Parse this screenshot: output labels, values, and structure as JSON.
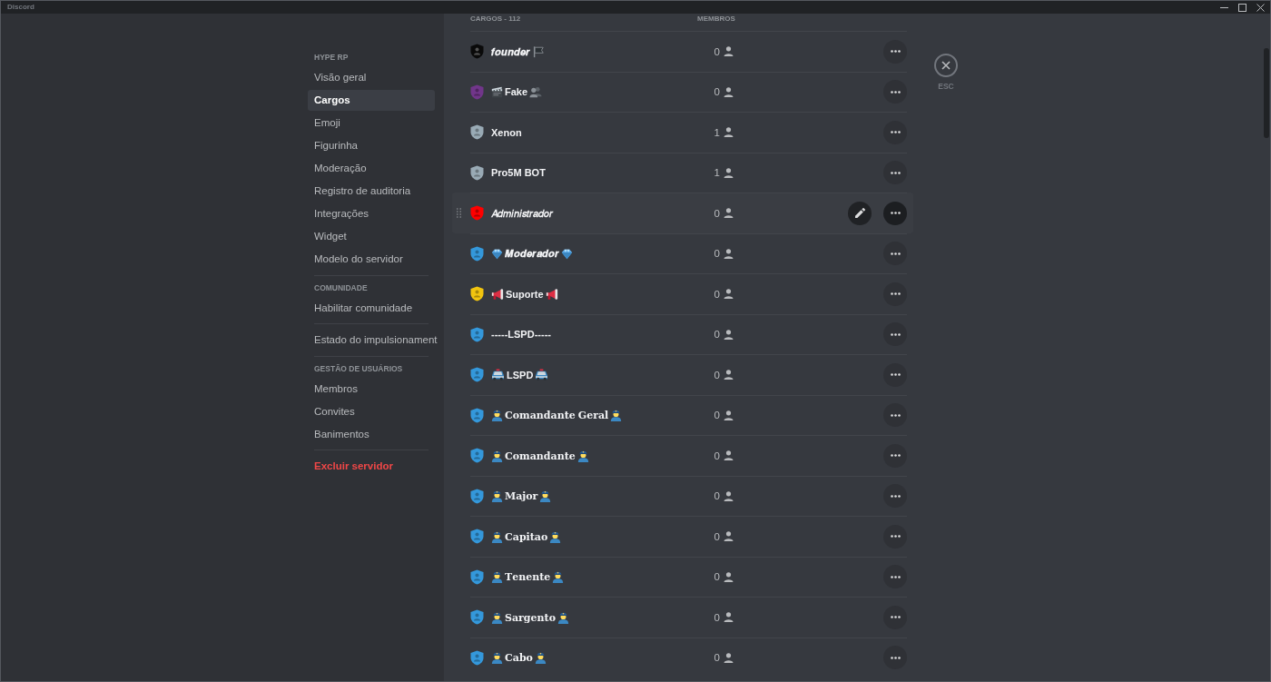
{
  "window": {
    "title": "Discord"
  },
  "sidebar": {
    "sections": [
      {
        "header": "HYPE RP",
        "items": [
          {
            "label": "Visão geral",
            "selected": false,
            "kind": "normal"
          },
          {
            "label": "Cargos",
            "selected": true,
            "kind": "normal"
          },
          {
            "label": "Emoji",
            "selected": false,
            "kind": "normal"
          },
          {
            "label": "Figurinha",
            "selected": false,
            "kind": "normal"
          },
          {
            "label": "Moderação",
            "selected": false,
            "kind": "normal"
          },
          {
            "label": "Registro de auditoria",
            "selected": false,
            "kind": "normal"
          },
          {
            "label": "Integrações",
            "selected": false,
            "kind": "normal"
          },
          {
            "label": "Widget",
            "selected": false,
            "kind": "normal"
          },
          {
            "label": "Modelo do servidor",
            "selected": false,
            "kind": "normal"
          }
        ]
      },
      {
        "header": "COMUNIDADE",
        "items": [
          {
            "label": "Habilitar comunidade",
            "selected": false,
            "kind": "normal"
          }
        ]
      },
      {
        "items": [
          {
            "label": "Estado do impulsionament",
            "selected": false,
            "kind": "normal"
          }
        ]
      },
      {
        "header": "GESTÃO DE USUÁRIOS",
        "items": [
          {
            "label": "Membros",
            "selected": false,
            "kind": "normal"
          },
          {
            "label": "Convites",
            "selected": false,
            "kind": "normal"
          },
          {
            "label": "Banimentos",
            "selected": false,
            "kind": "normal"
          }
        ]
      },
      {
        "items": [
          {
            "label": "Excluir servidor",
            "selected": false,
            "kind": "danger"
          }
        ]
      }
    ]
  },
  "roles_table": {
    "columns": [
      "CARGOS - 112",
      "MEMBROS"
    ],
    "roles": [
      {
        "name": "𝒇𝒐𝒖𝒏𝒅𝒆𝒓",
        "kind": "flag",
        "color": "#0a0a0a",
        "members": "0",
        "hovered": false
      },
      {
        "name": "Fake",
        "kind": "clapper",
        "color": "#71368a",
        "members": "0",
        "hovered": false
      },
      {
        "name": "Xenon",
        "kind": "plain",
        "color": "#99aab5",
        "members": "1",
        "hovered": false
      },
      {
        "name": "Pro5M BOT",
        "kind": "plain",
        "color": "#99aab5",
        "members": "1",
        "hovered": false
      },
      {
        "name": "𝐴𝑑𝑚𝑖𝑛𝑖𝑠𝑡𝑟𝑎𝑑𝑜𝑟",
        "kind": "plain",
        "color": "#ff0000",
        "members": "0",
        "hovered": true
      },
      {
        "name": "𝑴𝒐𝒅𝒆𝒓𝒂𝒅𝒐𝒓",
        "kind": "gem",
        "color": "#3498db",
        "members": "0",
        "hovered": false
      },
      {
        "name": "Suporte",
        "kind": "megaphone",
        "color": "#f1c40f",
        "members": "0",
        "hovered": false
      },
      {
        "name": "-----LSPD-----",
        "kind": "plain",
        "color": "#3498db",
        "members": "0",
        "hovered": false
      },
      {
        "name": "LSPD",
        "kind": "police-car",
        "color": "#3498db",
        "members": "0",
        "hovered": false
      },
      {
        "name": "𝐂𝐨𝐦𝐚𝐧𝐝𝐚𝐧𝐭𝐞 𝐆𝐞𝐫𝐚𝐥",
        "kind": "officer",
        "color": "#3498db",
        "members": "0",
        "hovered": false
      },
      {
        "name": "𝐂𝐨𝐦𝐚𝐧𝐝𝐚𝐧𝐭𝐞",
        "kind": "officer",
        "color": "#3498db",
        "members": "0",
        "hovered": false
      },
      {
        "name": "𝐌𝐚𝐣𝐨𝐫",
        "kind": "officer",
        "color": "#3498db",
        "members": "0",
        "hovered": false
      },
      {
        "name": "𝐂𝐚𝐩𝐢𝐭𝐚𝐨",
        "kind": "officer",
        "color": "#3498db",
        "members": "0",
        "hovered": false
      },
      {
        "name": "𝐓𝐞𝐧𝐞𝐧𝐭𝐞",
        "kind": "officer",
        "color": "#3498db",
        "members": "0",
        "hovered": false
      },
      {
        "name": "𝐒𝐚𝐫𝐠𝐞𝐧𝐭𝐨",
        "kind": "officer",
        "color": "#3498db",
        "members": "0",
        "hovered": false
      },
      {
        "name": "𝐂𝐚𝐛𝐨",
        "kind": "officer",
        "color": "#3498db",
        "members": "0",
        "hovered": false
      }
    ]
  },
  "close": {
    "keybind": "ESC"
  }
}
